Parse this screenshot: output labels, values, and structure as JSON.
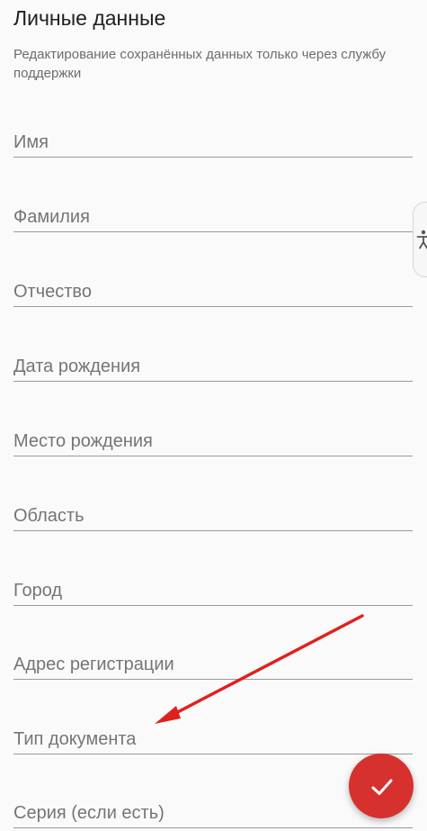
{
  "header": {
    "title": "Личные данные",
    "subtitle": "Редактирование сохранённых данных только через службу поддержки"
  },
  "form": {
    "fields": [
      {
        "label": "Имя"
      },
      {
        "label": "Фамилия"
      },
      {
        "label": "Отчество"
      },
      {
        "label": "Дата рождения"
      },
      {
        "label": "Место рождения"
      },
      {
        "label": "Область"
      },
      {
        "label": "Город"
      },
      {
        "label": "Адрес регистрации"
      },
      {
        "label": "Тип документа"
      },
      {
        "label": "Серия (если есть)"
      }
    ]
  },
  "icons": {
    "accessibility": "accessibility-icon",
    "save": "check-icon",
    "annotation": "arrow-icon"
  },
  "colors": {
    "accent": "#d6312f",
    "annotation_arrow": "#e02020",
    "field_underline": "#9a9a9a",
    "label_text": "#757575"
  }
}
